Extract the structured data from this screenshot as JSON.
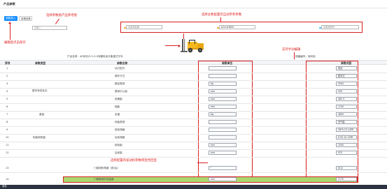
{
  "header": {
    "title": "产品参数"
  },
  "tabs": [
    {
      "label": "参数录入",
      "active": true
    },
    {
      "label": "查看参数",
      "active": false
    }
  ],
  "search": {
    "value": "请输入"
  },
  "filters": [
    {
      "value": "请选择品牌",
      "dot": "#f0a020"
    },
    {
      "value": "A24.0HB59",
      "dot": "#f0a020"
    },
    {
      "value": "请选择型号",
      "dot": "#2db7f5"
    }
  ],
  "annotations": {
    "ref_params": "选择参数类产品参考图",
    "edit_save": "编辑后点击保存",
    "config_params": "选择主要配置可自动带参参数",
    "manual_input": "支持手动编辑",
    "linked_params": "选择配置的发动机参数将变色回显"
  },
  "product": {
    "name_label": "产品名称：XE系列/3.5-3.0吨锂电池平衡重式叉车",
    "code_label": "规格编号：转向轮"
  },
  "table": {
    "headers": [
      "序号",
      "参数类型",
      "参数名称",
      "参数单位",
      "参数内容"
    ],
    "rows": [
      {
        "no": "1",
        "type": "",
        "name": "动力型式",
        "unit": "",
        "value": "电动"
      },
      {
        "no": "2",
        "type": "",
        "name": "操作方式",
        "unit": "",
        "value": "座驾式"
      },
      {
        "no": "3",
        "type": "整车特性标志",
        "name": "额定载荷",
        "unit": "Kg",
        "value": "3500"
      },
      {
        "no": "4",
        "type": "",
        "name": "载荷中心距",
        "unit": "mm",
        "value": "500"
      },
      {
        "no": "5",
        "type": "",
        "name": "前悬距",
        "unit": "mm",
        "value": "482.5"
      },
      {
        "no": "6",
        "type": "",
        "name": "轴距",
        "unit": "mm",
        "value": "1750"
      },
      {
        "no": "7",
        "type": "重量",
        "name": "自重",
        "unit": "Kg",
        "value": "4850"
      },
      {
        "no": "8",
        "type": "",
        "name": "轮胎类型",
        "unit": "",
        "value": "充气胎"
      },
      {
        "no": "9",
        "type": "",
        "name": "前轮规格",
        "unit": "",
        "value": "28*9-15-14PR"
      },
      {
        "no": "10",
        "type": "轮胎和底盘",
        "name": "后轮规格",
        "unit": "",
        "value": "6.50-10-10PR"
      },
      {
        "no": "11",
        "type": "",
        "name": "前轮距",
        "unit": "mm",
        "value": "1000"
      },
      {
        "no": "12",
        "type": "",
        "name": "后轮距",
        "unit": "mm",
        "value": "975"
      },
      {
        "no": "13",
        "type": "",
        "name": "门架倾斜角度（前/后）",
        "unit": "°",
        "value": "6/12"
      },
      {
        "no": "14",
        "type": "",
        "name": "门架降低时总高度",
        "unit": "mm",
        "value": "2170"
      }
    ]
  },
  "footer": {
    "label": "保存"
  },
  "colors": {
    "accent": "#1890ff",
    "annotation": "#e02020",
    "highlight_row": "#a9d86e"
  }
}
